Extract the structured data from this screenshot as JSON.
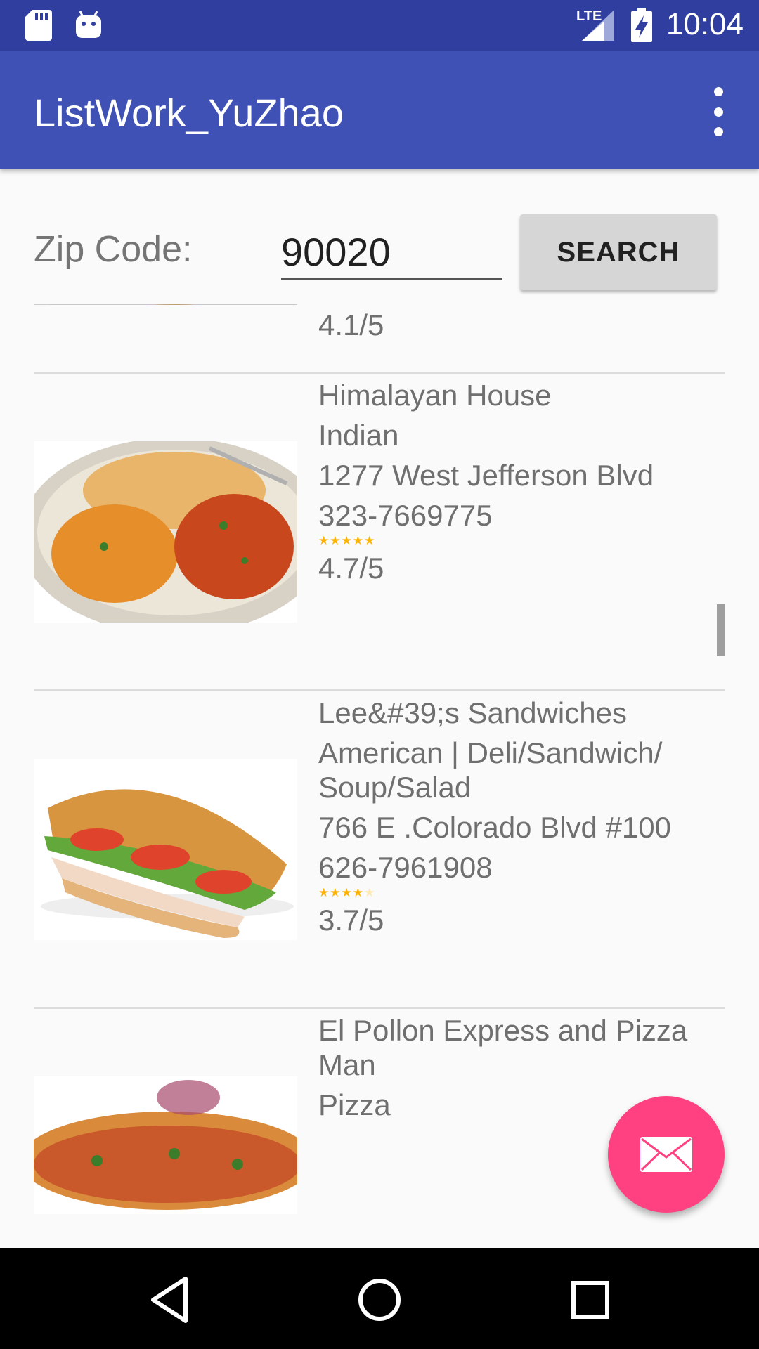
{
  "status_bar": {
    "time": "10:04",
    "network_label": "LTE",
    "icons": [
      "sd-card-icon",
      "android-icon",
      "lte-signal-icon",
      "battery-charging-icon"
    ]
  },
  "app_bar": {
    "title": "ListWork_YuZhao",
    "overflow_icon": "more-vert-icon"
  },
  "search": {
    "label": "Zip Code:",
    "value": "90020",
    "button_label": "SEARCH"
  },
  "restaurants": [
    {
      "name": "",
      "cuisine": "",
      "address": "",
      "phone": "",
      "stars": 4.1,
      "rating": "4.1/5",
      "image": "curry-dish-image"
    },
    {
      "name": "Himalayan House",
      "cuisine": "Indian",
      "address": "1277 West Jefferson Blvd",
      "phone": "323-7669775",
      "stars": 4.7,
      "rating": "4.7/5",
      "image": "indian-food-image"
    },
    {
      "name": "Lee&#39;s Sandwiches",
      "cuisine": "American | Deli/Sandwich/ Soup/Salad",
      "address": "766 E .Colorado Blvd #100",
      "phone": "626-7961908",
      "stars": 3.7,
      "rating": "3.7/5",
      "image": "sandwich-image"
    },
    {
      "name": "El Pollon Express and Pizza Man",
      "cuisine": "Pizza",
      "address": "",
      "phone": "",
      "stars": null,
      "rating": "",
      "image": "pizza-image"
    }
  ],
  "fab": {
    "icon": "email-icon"
  },
  "nav_bar": {
    "icons": [
      "back-icon",
      "home-icon",
      "recents-icon"
    ]
  },
  "colors": {
    "status_bar": "#303f9f",
    "app_bar": "#3f51b5",
    "accent": "#ff4081",
    "star": "#ffb300"
  }
}
